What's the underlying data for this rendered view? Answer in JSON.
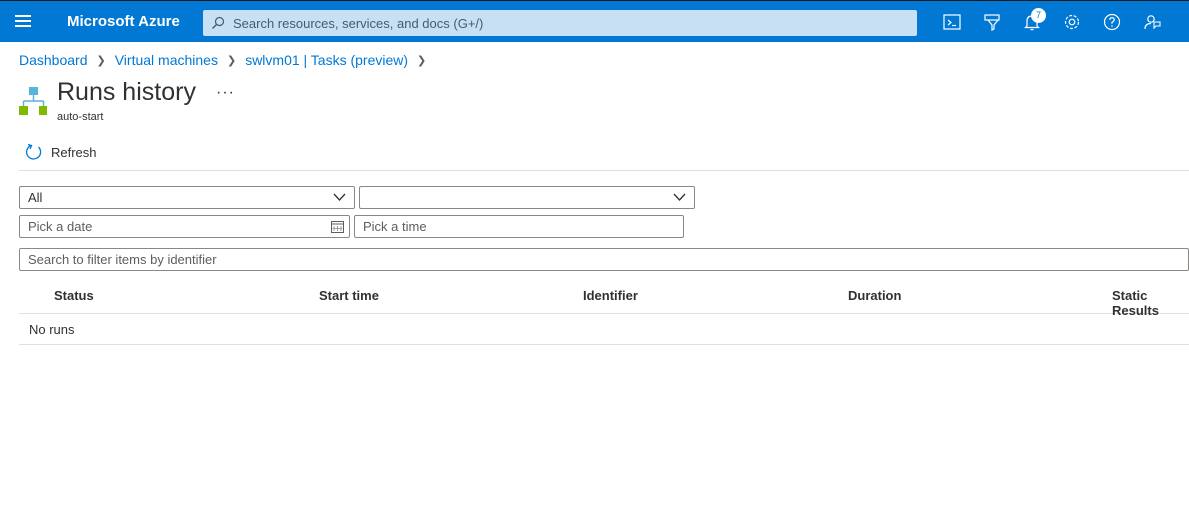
{
  "header": {
    "brand": "Microsoft Azure",
    "search_placeholder": "Search resources, services, and docs (G+/)",
    "notification_count": "7",
    "icons": [
      "menu-icon",
      "search-icon",
      "cloud-shell-icon",
      "directory-filter-icon",
      "notifications-icon",
      "settings-icon",
      "help-icon",
      "feedback-icon"
    ]
  },
  "breadcrumb": {
    "items": [
      "Dashboard",
      "Virtual machines",
      "swlvm01 | Tasks (preview)"
    ]
  },
  "page": {
    "title": "Runs history",
    "more": "···",
    "subtitle": "auto-start"
  },
  "toolbar": {
    "refresh_label": "Refresh"
  },
  "filters": {
    "status_value": "All",
    "second_value": "",
    "date_placeholder": "Pick a date",
    "time_placeholder": "Pick a time",
    "identifier_placeholder": "Search to filter items by identifier"
  },
  "table": {
    "columns": [
      "Status",
      "Start time",
      "Identifier",
      "Duration",
      "Static Results"
    ],
    "empty_text": "No runs"
  },
  "colors": {
    "accent": "#0078d4",
    "search_bg": "#c7e0f4"
  }
}
